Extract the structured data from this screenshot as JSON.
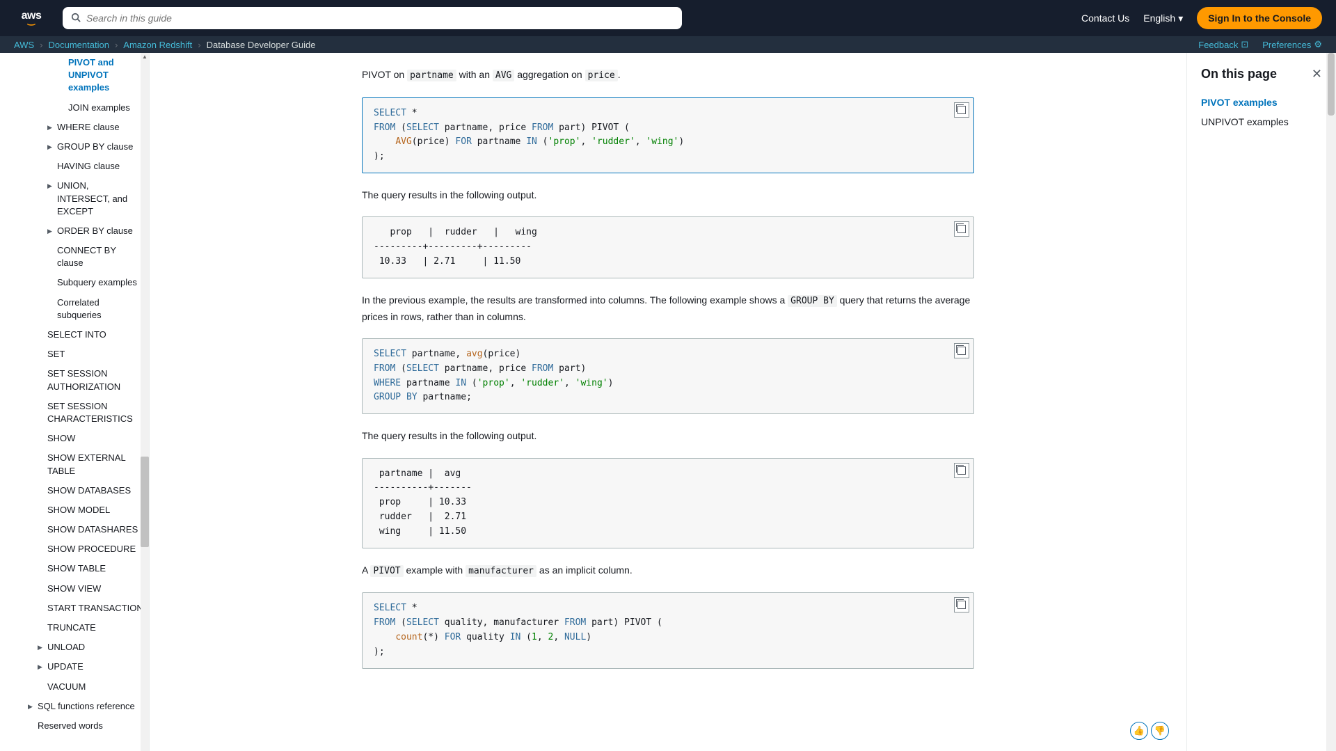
{
  "header": {
    "search_placeholder": "Search in this guide",
    "contact": "Contact Us",
    "language": "English",
    "signin": "Sign In to the Console"
  },
  "breadcrumb": {
    "items": [
      "AWS",
      "Documentation",
      "Amazon Redshift",
      "Database Developer Guide"
    ],
    "feedback": "Feedback",
    "preferences": "Preferences"
  },
  "sidebar": {
    "items": [
      {
        "label": "PIVOT and UNPIVOT examples",
        "indent": 4,
        "active": true,
        "caret": false
      },
      {
        "label": "JOIN examples",
        "indent": 4,
        "active": false,
        "caret": false
      },
      {
        "label": "WHERE clause",
        "indent": 3,
        "active": false,
        "caret": true
      },
      {
        "label": "GROUP BY clause",
        "indent": 3,
        "active": false,
        "caret": true
      },
      {
        "label": "HAVING clause",
        "indent": 3,
        "active": false,
        "caret": false
      },
      {
        "label": "UNION, INTERSECT, and EXCEPT",
        "indent": 3,
        "active": false,
        "caret": true
      },
      {
        "label": "ORDER BY clause",
        "indent": 3,
        "active": false,
        "caret": true
      },
      {
        "label": "CONNECT BY clause",
        "indent": 3,
        "active": false,
        "caret": false
      },
      {
        "label": "Subquery examples",
        "indent": 3,
        "active": false,
        "caret": false
      },
      {
        "label": "Correlated subqueries",
        "indent": 3,
        "active": false,
        "caret": false
      },
      {
        "label": "SELECT INTO",
        "indent": 2,
        "active": false,
        "caret": false
      },
      {
        "label": "SET",
        "indent": 2,
        "active": false,
        "caret": false
      },
      {
        "label": "SET SESSION AUTHORIZATION",
        "indent": 2,
        "active": false,
        "caret": false
      },
      {
        "label": "SET SESSION CHARACTERISTICS",
        "indent": 2,
        "active": false,
        "caret": false
      },
      {
        "label": "SHOW",
        "indent": 2,
        "active": false,
        "caret": false
      },
      {
        "label": "SHOW EXTERNAL TABLE",
        "indent": 2,
        "active": false,
        "caret": false
      },
      {
        "label": "SHOW DATABASES",
        "indent": 2,
        "active": false,
        "caret": false
      },
      {
        "label": "SHOW MODEL",
        "indent": 2,
        "active": false,
        "caret": false
      },
      {
        "label": "SHOW DATASHARES",
        "indent": 2,
        "active": false,
        "caret": false
      },
      {
        "label": "SHOW PROCEDURE",
        "indent": 2,
        "active": false,
        "caret": false
      },
      {
        "label": "SHOW TABLE",
        "indent": 2,
        "active": false,
        "caret": false
      },
      {
        "label": "SHOW VIEW",
        "indent": 2,
        "active": false,
        "caret": false
      },
      {
        "label": "START TRANSACTION",
        "indent": 2,
        "active": false,
        "caret": false
      },
      {
        "label": "TRUNCATE",
        "indent": 2,
        "active": false,
        "caret": false
      },
      {
        "label": "UNLOAD",
        "indent": 2,
        "active": false,
        "caret": true
      },
      {
        "label": "UPDATE",
        "indent": 2,
        "active": false,
        "caret": true
      },
      {
        "label": "VACUUM",
        "indent": 2,
        "active": false,
        "caret": false
      },
      {
        "label": "SQL functions reference",
        "indent": 1,
        "active": false,
        "caret": true
      },
      {
        "label": "Reserved words",
        "indent": 1,
        "active": false,
        "caret": false
      }
    ]
  },
  "content": {
    "p1_pre": "PIVOT on ",
    "p1_code1": "partname",
    "p1_mid": " with an ",
    "p1_code2": "AVG",
    "p1_mid2": " aggregation on ",
    "p1_code3": "price",
    "p1_end": ".",
    "p2": "The query results in the following output.",
    "output1": "   prop   |  rudder   |   wing\n---------+---------+---------\n 10.33   | 2.71     | 11.50",
    "p3_pre": "In the previous example, the results are transformed into columns. The following example shows a ",
    "p3_code": "GROUP BY",
    "p3_post": " query that returns the average prices in rows, rather than in columns.",
    "p4": "The query results in the following output.",
    "output2": " partname |  avg\n----------+-------\n prop     | 10.33\n rudder   |  2.71\n wing     | 11.50",
    "p5_pre": "A ",
    "p5_code1": "PIVOT",
    "p5_mid": " example with ",
    "p5_code2": "manufacturer",
    "p5_post": " as an implicit column."
  },
  "rightPanel": {
    "title": "On this page",
    "links": [
      {
        "label": "PIVOT examples",
        "active": true
      },
      {
        "label": "UNPIVOT examples",
        "active": false
      }
    ]
  }
}
